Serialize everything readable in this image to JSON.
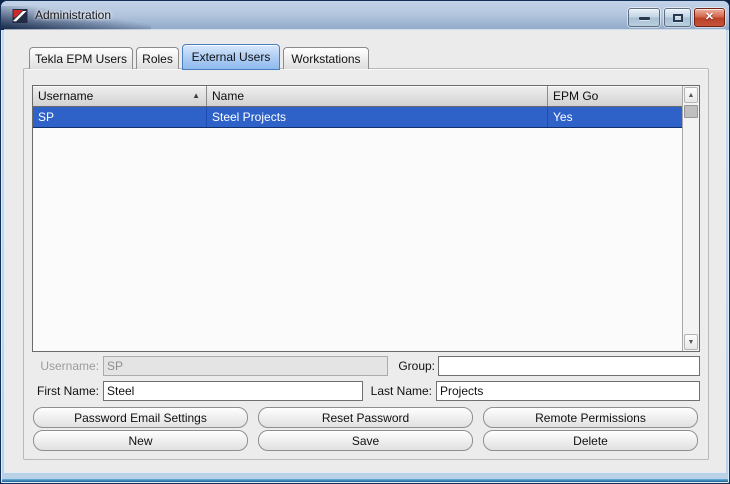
{
  "window": {
    "title": "Administration"
  },
  "icons": {
    "app": "tekla-logo",
    "minimize": "minimize-bar",
    "maximize": "maximize-square",
    "close": "✕",
    "sort_ascending": "▲",
    "scroll_up": "▲",
    "scroll_down": "▼"
  },
  "tabs": [
    {
      "label": "Tekla EPM Users",
      "selected": false
    },
    {
      "label": "Roles",
      "selected": false
    },
    {
      "label": "External Users",
      "selected": true
    },
    {
      "label": "Workstations",
      "selected": false
    }
  ],
  "table": {
    "columns": [
      {
        "label": "Username",
        "sorted": "ascending"
      },
      {
        "label": "Name"
      },
      {
        "label": "EPM Go"
      }
    ],
    "rows": [
      {
        "cells": [
          "SP",
          "Steel Projects",
          "Yes"
        ],
        "selected": true
      }
    ]
  },
  "form": {
    "username": {
      "label": "Username:",
      "value": "SP",
      "state": "disabled"
    },
    "group": {
      "label": "Group:",
      "value": ""
    },
    "first_name": {
      "label": "First Name:",
      "value": "Steel"
    },
    "last_name": {
      "label": "Last Name:",
      "value": "Projects"
    }
  },
  "action_buttons": [
    {
      "label": "Password Email Settings"
    },
    {
      "label": "Reset Password"
    },
    {
      "label": "Remote Permissions"
    },
    {
      "label": "New"
    },
    {
      "label": "Save"
    },
    {
      "label": "Delete"
    }
  ],
  "colors": {
    "selected_row": "#2E62C8",
    "selected_tab": "#8FBAEE",
    "titlebar_top": "#C3D3E8",
    "titlebar_bottom": "#8FA9C9",
    "close_button": "#BB4128",
    "client_background": "#EBEBEB"
  }
}
